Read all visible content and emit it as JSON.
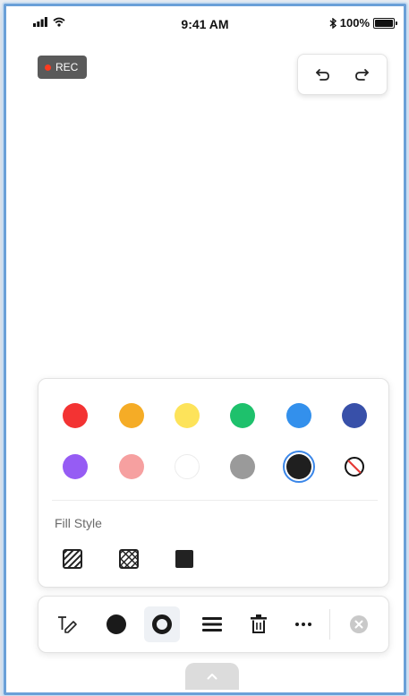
{
  "status_bar": {
    "time": "9:41 AM",
    "battery_text": "100%",
    "icons": [
      "signal-icon",
      "wifi-icon",
      "bluetooth-icon",
      "battery-icon"
    ]
  },
  "recording_badge": {
    "label": "REC",
    "dot_color": "#ff3b1f"
  },
  "history_controls": {
    "undo_icon": "undo-icon",
    "redo_icon": "redo-icon"
  },
  "colors": {
    "row1": [
      "#f33333",
      "#f5ac26",
      "#fde35a",
      "#1ec16c",
      "#3390ec",
      "#3850a9"
    ],
    "row2": [
      "#965cf4",
      "#f6a0a0",
      "#ffffff",
      "#9a9a9a",
      "#1f1f1f",
      "none"
    ],
    "selected": "#1f1f1f",
    "selection_ring": "#3a86e8"
  },
  "fill_style": {
    "label": "Fill Style",
    "options": [
      "hatch-fill-icon",
      "crosshatch-fill-icon",
      "solid-fill-icon"
    ]
  },
  "toolbar": {
    "tools": [
      "text-tool-icon",
      "fill-dot-icon",
      "stroke-ring-icon",
      "lines-icon",
      "trash-icon",
      "more-icon",
      "close-icon"
    ],
    "active": "stroke-ring-icon"
  },
  "pull_tab": {
    "icon": "chevron-up-icon"
  }
}
